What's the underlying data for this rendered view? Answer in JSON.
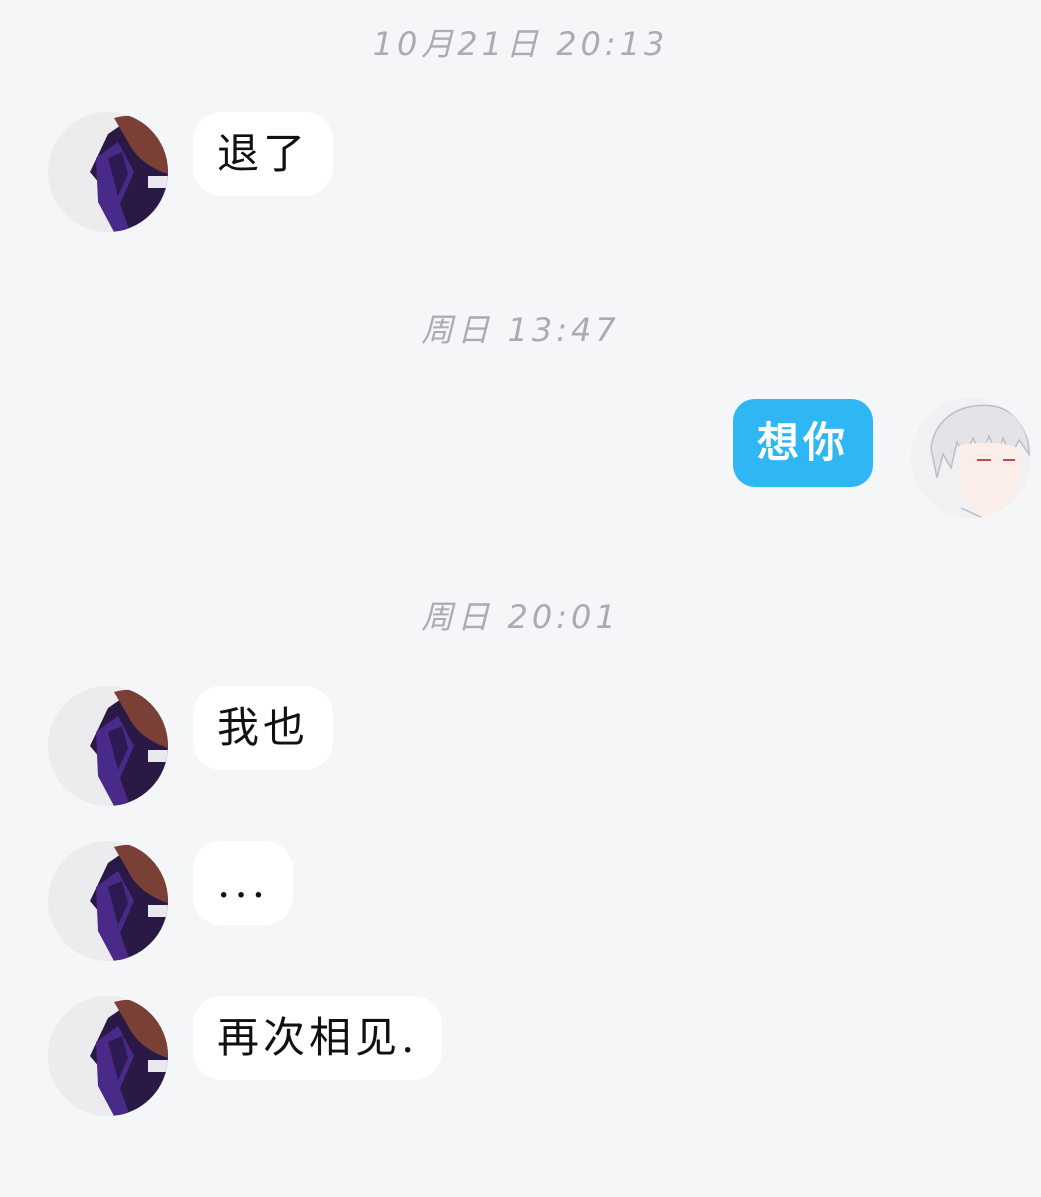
{
  "timestamps": [
    "10月21日 20:13",
    "周日 13:47",
    "周日 20:01"
  ],
  "messages": [
    {
      "sender": "other",
      "text": "退了"
    },
    {
      "sender": "me",
      "text": "想你"
    },
    {
      "sender": "other",
      "text": "我也"
    },
    {
      "sender": "other",
      "text": "..."
    },
    {
      "sender": "other",
      "text": "再次相见."
    }
  ],
  "colors": {
    "background": "#f5f6f8",
    "incoming_bubble": "#ffffff",
    "outgoing_bubble": "#2fb6f5",
    "timestamp_text": "#a9adb3"
  },
  "avatars": {
    "other": "dark-purple-hooded-character-avatar",
    "me": "white-haired-character-avatar"
  }
}
